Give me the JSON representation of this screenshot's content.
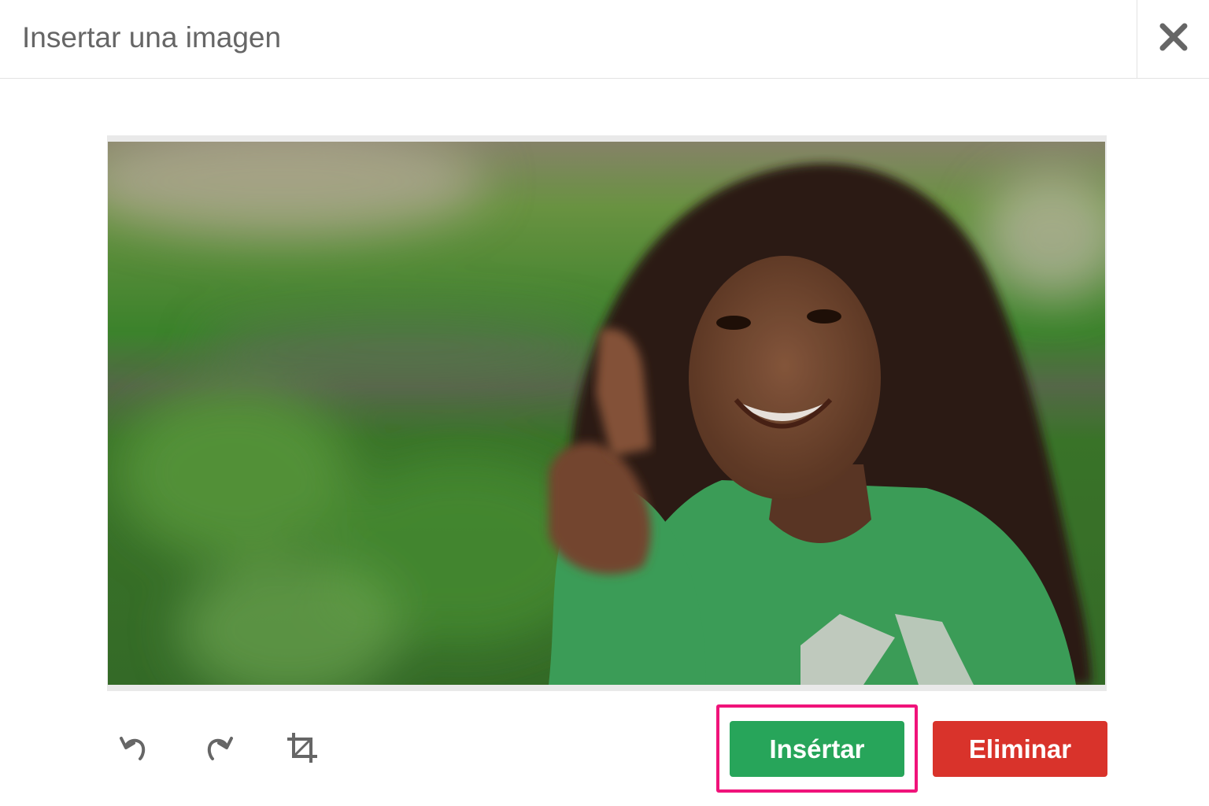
{
  "dialog": {
    "title": "Insertar una imagen",
    "close_icon": "close-icon"
  },
  "image": {
    "alt_icon": "photo-preview"
  },
  "toolbar": {
    "undo_icon": "undo-icon",
    "redo_icon": "redo-icon",
    "crop_icon": "crop-icon"
  },
  "actions": {
    "insert_label": "Insértar",
    "delete_label": "Eliminar"
  },
  "colors": {
    "insert": "#27a55a",
    "delete": "#d9332b",
    "highlight": "#f0137a",
    "title": "#666666"
  }
}
